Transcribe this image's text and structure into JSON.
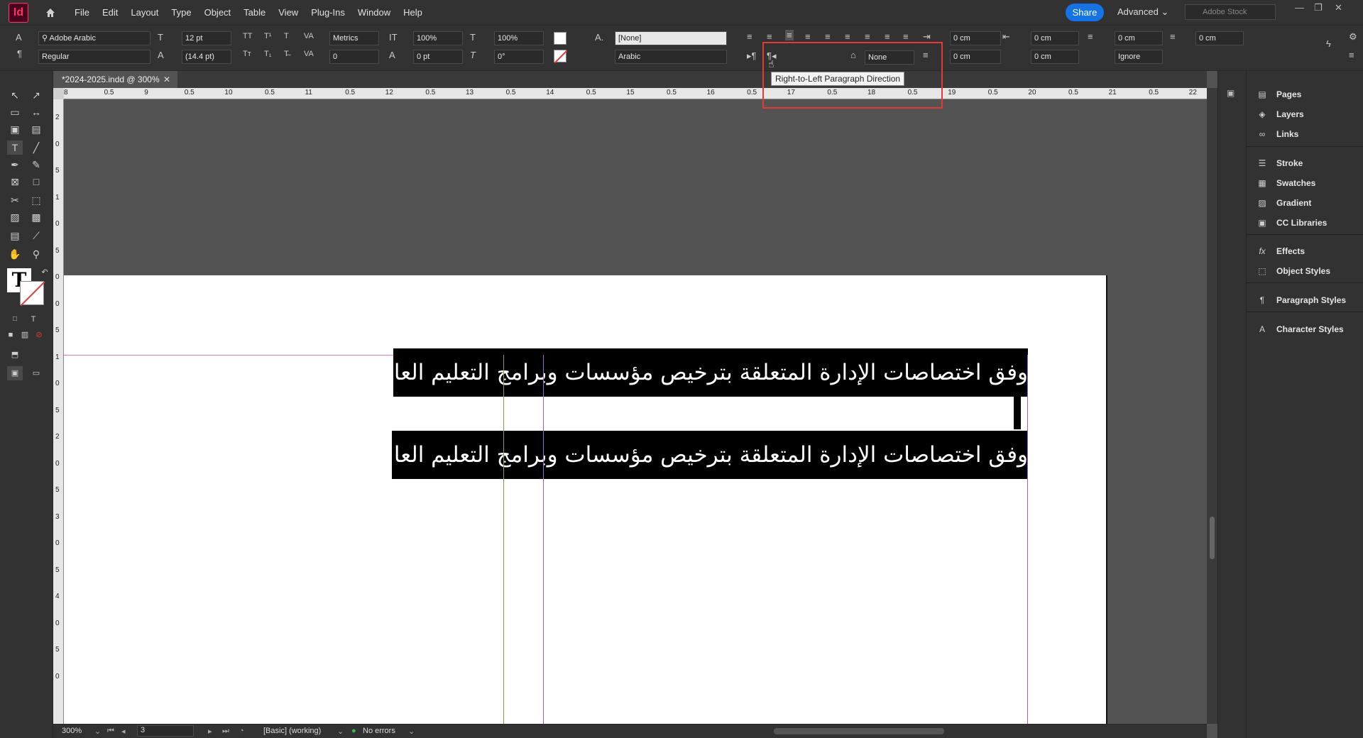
{
  "app": {
    "logo": "Id",
    "menus": [
      "File",
      "Edit",
      "Layout",
      "Type",
      "Object",
      "Table",
      "View",
      "Plug-Ins",
      "Window",
      "Help"
    ],
    "share_label": "Share",
    "workspace_label": "Advanced",
    "stock_placeholder": "Adobe Stock"
  },
  "control": {
    "font_family": "Adobe Arabic",
    "font_style": "Regular",
    "font_size": "12 pt",
    "leading": "(14.4 pt)",
    "kerning": "Metrics",
    "tracking": "0",
    "vscale": "100%",
    "hscale": "100%",
    "baseline_shift": "0 pt",
    "skew": "0°",
    "char_style": "[None]",
    "language": "Arabic",
    "indent_left": "0 cm",
    "indent_right": "0 cm",
    "space_before": "0 cm",
    "space_after": "0 cm",
    "first_line_indent": "0 cm",
    "last_line_indent": "0 cm",
    "drop_cap_lines": "0 cm",
    "dropcap_none": "None",
    "ignore": "Ignore"
  },
  "document": {
    "tab_title": "*2024-2025.indd @ 300%",
    "line1": "وفق اختصاصات الإدارة المتعلقة بترخيص مؤسسات وبرامج التعليم العالي،",
    "line2": "وفق اختصاصات الإدارة المتعلقة بترخيص مؤسسات وبرامج التعليم العالي!"
  },
  "ruler": {
    "h_labels": [
      "8",
      "0.5",
      "9",
      "0.5",
      "10",
      "0.5",
      "11",
      "0.5",
      "12",
      "0.5",
      "13",
      "0.5",
      "14",
      "0.5",
      "15",
      "0.5",
      "16",
      "0.5",
      "17",
      "0.5",
      "18",
      "0.5",
      "19",
      "0.5",
      "20",
      "0.5",
      "21",
      "0.5",
      "22"
    ],
    "v_labels": [
      "2",
      "0",
      "5",
      "1",
      "0",
      "5",
      "0",
      "0",
      "5",
      "1",
      "0",
      "5",
      "2",
      "0",
      "5",
      "3",
      "0",
      "5",
      "4",
      "0",
      "5",
      "0"
    ]
  },
  "tooltip": "Right-to-Left Paragraph Direction",
  "status": {
    "zoom": "300%",
    "page": "3",
    "style": "[Basic] (working)",
    "preflight": "No errors"
  },
  "panels": [
    "Pages",
    "Layers",
    "Links",
    "Stroke",
    "Swatches",
    "Gradient",
    "CC Libraries",
    "Effects",
    "Object Styles",
    "Paragraph Styles",
    "Character Styles"
  ]
}
